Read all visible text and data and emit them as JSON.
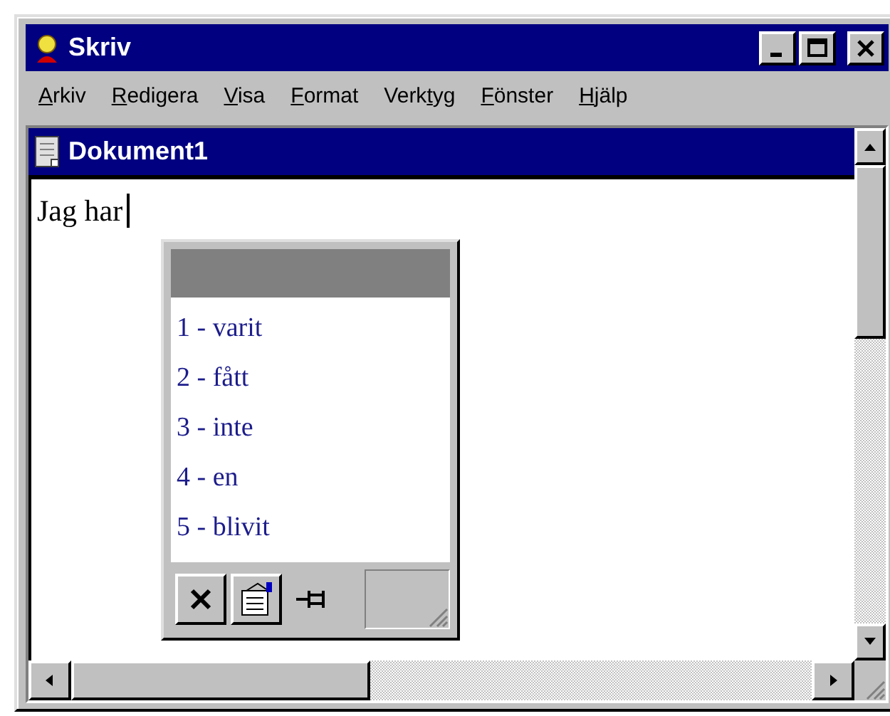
{
  "window": {
    "title": "Skriv"
  },
  "menu": [
    {
      "key": "A",
      "after": "rkiv"
    },
    {
      "key": "R",
      "after": "edigera"
    },
    {
      "key": "V",
      "after": "isa"
    },
    {
      "key": "F",
      "after": "ormat"
    },
    {
      "before": "Verk",
      "key": "t",
      "after": "yg"
    },
    {
      "key": "F",
      "after": "önster"
    },
    {
      "key": "H",
      "after": "jälp"
    }
  ],
  "document": {
    "title": "Dokument1",
    "text": "Jag har"
  },
  "prediction_popup": {
    "items": [
      "1 - varit",
      "2 - fått",
      "3 - inte",
      "4 - en",
      "5 - blivit"
    ]
  }
}
